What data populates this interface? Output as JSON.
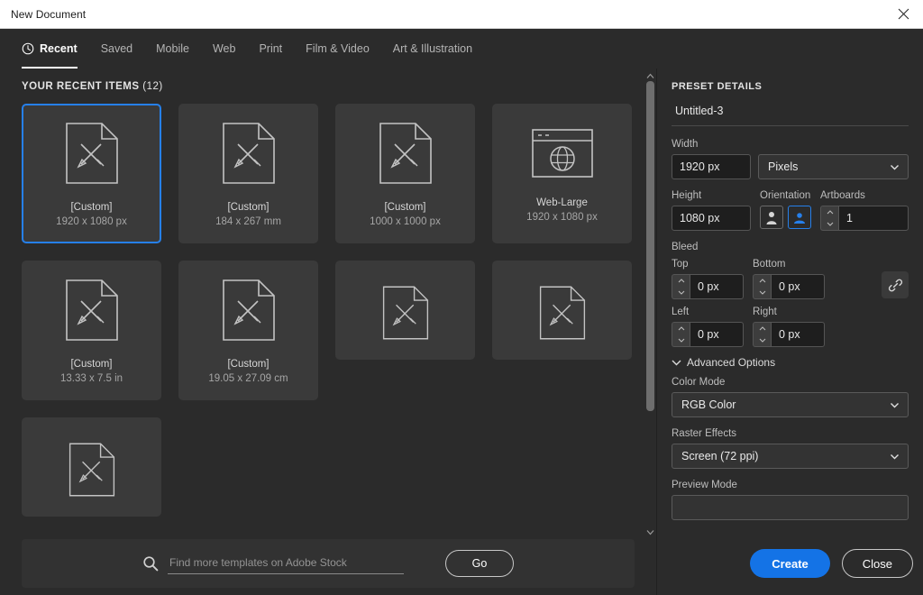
{
  "titlebar": {
    "title": "New Document",
    "close_icon": "close-icon"
  },
  "tabs": [
    {
      "label": "Recent",
      "icon": "clock-icon",
      "active": true
    },
    {
      "label": "Saved",
      "active": false
    },
    {
      "label": "Mobile",
      "active": false
    },
    {
      "label": "Web",
      "active": false
    },
    {
      "label": "Print",
      "active": false
    },
    {
      "label": "Film & Video",
      "active": false
    },
    {
      "label": "Art & Illustration",
      "active": false
    }
  ],
  "recent": {
    "header": "YOUR RECENT ITEMS",
    "count": "(12)",
    "items": [
      {
        "title": "[Custom]",
        "size": "1920 x 1080 px",
        "icon": "document-icon",
        "selected": true
      },
      {
        "title": "[Custom]",
        "size": "184 x 267 mm",
        "icon": "document-icon",
        "selected": false
      },
      {
        "title": "[Custom]",
        "size": "1000 x 1000 px",
        "icon": "document-icon",
        "selected": false
      },
      {
        "title": "Web-Large",
        "size": "1920 x 1080 px",
        "icon": "browser-globe-icon",
        "selected": false
      },
      {
        "title": "[Custom]",
        "size": "13.33 x 7.5 in",
        "icon": "document-icon",
        "selected": false
      },
      {
        "title": "[Custom]",
        "size": "19.05 x 27.09 cm",
        "icon": "document-icon",
        "selected": false
      },
      {
        "title": "",
        "size": "",
        "icon": "document-icon",
        "selected": false
      },
      {
        "title": "",
        "size": "",
        "icon": "document-icon",
        "selected": false
      },
      {
        "title": "",
        "size": "",
        "icon": "document-icon",
        "selected": false
      }
    ]
  },
  "search": {
    "placeholder": "Find more templates on Adobe Stock",
    "value": "",
    "icon": "search-icon",
    "go_label": "Go"
  },
  "preset": {
    "header": "PRESET DETAILS",
    "name_value": "Untitled-3",
    "width": {
      "label": "Width",
      "value": "1920 px"
    },
    "units": {
      "value": "Pixels"
    },
    "height": {
      "label": "Height",
      "value": "1080 px"
    },
    "orientation": {
      "label": "Orientation",
      "portrait_icon": "portrait-icon",
      "landscape_icon": "landscape-icon",
      "selected": "landscape"
    },
    "artboards": {
      "label": "Artboards",
      "value": "1"
    },
    "bleed": {
      "label": "Bleed",
      "top": {
        "label": "Top",
        "value": "0 px"
      },
      "bottom": {
        "label": "Bottom",
        "value": "0 px"
      },
      "left": {
        "label": "Left",
        "value": "0 px"
      },
      "right": {
        "label": "Right",
        "value": "0 px"
      },
      "link_icon": "link-icon"
    },
    "advanced": {
      "label": "Advanced Options",
      "chevron_icon": "chevron-down-icon",
      "color_mode": {
        "label": "Color Mode",
        "value": "RGB Color"
      },
      "raster_effects": {
        "label": "Raster Effects",
        "value": "Screen (72 ppi)"
      },
      "preview_mode": {
        "label": "Preview Mode"
      }
    }
  },
  "footer": {
    "create_label": "Create",
    "close_label": "Close"
  },
  "colors": {
    "accent": "#1473e6",
    "selection": "#2680eb",
    "panel_bg": "#2b2b2b",
    "card_bg": "#3a3a3a"
  }
}
